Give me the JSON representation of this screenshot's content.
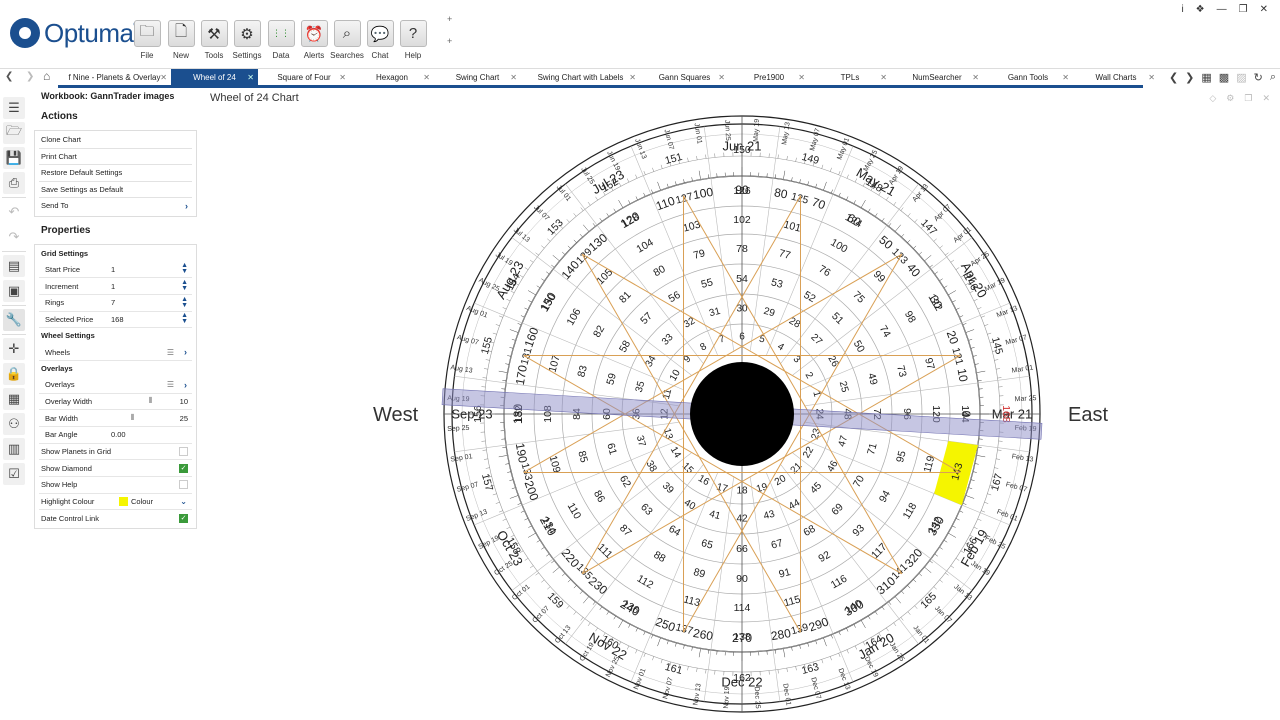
{
  "app": {
    "brand": "Optuma",
    "brand_mark": "®",
    "brand_color": "#1b4f8f",
    "window_controls": [
      "i",
      "❖",
      "—",
      "❐",
      "✕"
    ]
  },
  "ribbon": {
    "buttons": [
      {
        "label": "File",
        "icon": "folder-icon",
        "glyph": "🗀"
      },
      {
        "label": "New",
        "icon": "new-document-icon",
        "glyph": "🗋"
      },
      {
        "label": "Tools",
        "icon": "tools-icon",
        "glyph": "⚒"
      },
      {
        "label": "Settings",
        "icon": "gear-icon",
        "glyph": "⚙"
      },
      {
        "label": "Data",
        "icon": "data-icon",
        "glyph": "⋮⋮"
      },
      {
        "label": "Alerts",
        "icon": "alarm-clock-icon",
        "glyph": "⏰"
      },
      {
        "label": "Searches",
        "icon": "search-icon",
        "glyph": "⌕"
      },
      {
        "label": "Chat",
        "icon": "chat-icon",
        "glyph": "💬"
      },
      {
        "label": "Help",
        "icon": "help-icon",
        "glyph": "?"
      }
    ],
    "plus": "+"
  },
  "tabbar": {
    "tabs": [
      {
        "label": "f Nine - Planets & Overlay",
        "active": false
      },
      {
        "label": "Wheel of 24",
        "active": true
      },
      {
        "label": "Square of Four",
        "active": false
      },
      {
        "label": "Hexagon",
        "active": false
      },
      {
        "label": "Swing Chart",
        "active": false
      },
      {
        "label": "Swing Chart with Labels",
        "active": false
      },
      {
        "label": "Gann Squares",
        "active": false
      },
      {
        "label": "Pre1900",
        "active": false
      },
      {
        "label": "TPLs",
        "active": false
      },
      {
        "label": "NumSearcher",
        "active": false
      },
      {
        "label": "Gann Tools",
        "active": false
      },
      {
        "label": "Wall Charts",
        "active": false
      }
    ],
    "close_glyph": "✕"
  },
  "panel": {
    "workbook_title": "Workbook: GannTrader images",
    "actions_title": "Actions",
    "actions": [
      "Clone Chart",
      "Print Chart",
      "Restore Default Settings",
      "Save Settings as Default",
      "Send To"
    ],
    "properties_title": "Properties",
    "grid_settings": "Grid Settings",
    "start_price_label": "Start Price",
    "start_price": "1",
    "increment_label": "Increment",
    "increment": "1",
    "rings_label": "Rings",
    "rings": "7",
    "selected_price_label": "Selected Price",
    "selected_price": "168",
    "wheel_settings": "Wheel Settings",
    "wheels_label": "Wheels",
    "overlays_group": "Overlays",
    "overlays_label": "Overlays",
    "overlay_width_label": "Overlay Width",
    "overlay_width": "10",
    "bar_width_label": "Bar Width",
    "bar_width": "25",
    "bar_angle_label": "Bar Angle",
    "bar_angle": "0.00",
    "show_planets_label": "Show Planets in Grid",
    "show_planets": false,
    "show_diamond_label": "Show Diamond",
    "show_diamond": true,
    "show_help_label": "Show Help",
    "show_help": false,
    "highlight_colour_label": "Highlight Colour",
    "highlight_colour_text": "Colour",
    "highlight_colour": "#f5f500",
    "date_control_label": "Date Control Link",
    "date_control": true
  },
  "chart": {
    "title": "Wheel of 24 Chart",
    "west": "West",
    "east": "East",
    "highlight_value": "144",
    "selected_value": "168",
    "overlay_color": "#d9a055",
    "bar_color": "#8e8ec8",
    "highlight_color": "#f5f500",
    "center_color": "#000000",
    "ring_values": [
      [
        1,
        2,
        3,
        4,
        5,
        6,
        7,
        8,
        9,
        10,
        11,
        12,
        13,
        14,
        15,
        16,
        17,
        18,
        19,
        20,
        21,
        22,
        23,
        24
      ],
      [
        25,
        26,
        27,
        28,
        29,
        30,
        31,
        32,
        33,
        34,
        35,
        36,
        37,
        38,
        39,
        40,
        41,
        42,
        43,
        44,
        45,
        46,
        47,
        48
      ],
      [
        49,
        50,
        51,
        52,
        53,
        54,
        55,
        56,
        57,
        58,
        59,
        60,
        61,
        62,
        63,
        64,
        65,
        66,
        67,
        68,
        69,
        70,
        71,
        72
      ],
      [
        73,
        74,
        75,
        76,
        77,
        78,
        79,
        80,
        81,
        82,
        83,
        84,
        85,
        86,
        87,
        88,
        89,
        90,
        91,
        92,
        93,
        94,
        95,
        96
      ],
      [
        97,
        98,
        99,
        100,
        101,
        102,
        103,
        104,
        105,
        106,
        107,
        108,
        109,
        110,
        111,
        112,
        113,
        114,
        115,
        116,
        117,
        118,
        119,
        120
      ],
      [
        121,
        122,
        123,
        124,
        125,
        126,
        127,
        128,
        129,
        130,
        131,
        132,
        133,
        134,
        135,
        136,
        137,
        138,
        139,
        140,
        141,
        142,
        143,
        144
      ],
      [
        145,
        146,
        147,
        148,
        149,
        150,
        151,
        152,
        153,
        154,
        155,
        156,
        157,
        158,
        159,
        160,
        161,
        162,
        163,
        164,
        165,
        166,
        167,
        168
      ]
    ],
    "degree_labels": [
      "0",
      "10",
      "20",
      "30",
      "40",
      "50",
      "60",
      "70",
      "80",
      "90",
      "100",
      "110",
      "120",
      "130",
      "140",
      "150",
      "160",
      "170",
      "180",
      "190",
      "200",
      "210",
      "220",
      "230",
      "240",
      "250",
      "260",
      "270",
      "280",
      "290",
      "300",
      "310",
      "320",
      "330",
      "340",
      "350"
    ],
    "month_labels": [
      {
        "label": "Mar 21",
        "deg": 0
      },
      {
        "label": "Apr 20",
        "deg": 30
      },
      {
        "label": "May 21",
        "deg": 60
      },
      {
        "label": "Jun 21",
        "deg": 90
      },
      {
        "label": "Jul 23",
        "deg": 120
      },
      {
        "label": "Aug 23",
        "deg": 150
      },
      {
        "label": "Sep 23",
        "deg": 180
      },
      {
        "label": "Oct 23",
        "deg": 210
      },
      {
        "label": "Nov 22",
        "deg": 240
      },
      {
        "label": "Dec 22",
        "deg": 270
      },
      {
        "label": "Jan 20",
        "deg": 300
      },
      {
        "label": "Feb 19",
        "deg": 330
      }
    ],
    "month_abbrs": [
      "Mar",
      "Apr",
      "May",
      "Jun",
      "Jul",
      "Aug",
      "Sep",
      "Oct",
      "Nov",
      "Dec",
      "Jan",
      "Feb"
    ]
  }
}
